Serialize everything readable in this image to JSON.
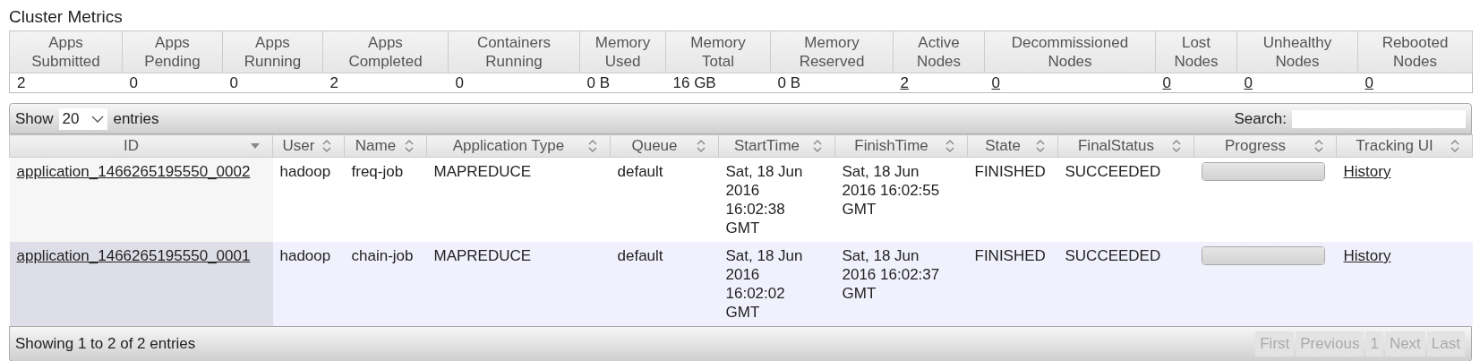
{
  "title": "Cluster Metrics",
  "metrics": [
    {
      "label": "Apps Submitted",
      "value": "2",
      "link": false
    },
    {
      "label": "Apps Pending",
      "value": "0",
      "link": false
    },
    {
      "label": "Apps Running",
      "value": "0",
      "link": false
    },
    {
      "label": "Apps Completed",
      "value": "2",
      "link": false
    },
    {
      "label": "Containers Running",
      "value": "0",
      "link": false
    },
    {
      "label": "Memory Used",
      "value": "0 B",
      "link": false
    },
    {
      "label": "Memory Total",
      "value": "16 GB",
      "link": false
    },
    {
      "label": "Memory Reserved",
      "value": "0 B",
      "link": false
    },
    {
      "label": "Active Nodes",
      "value": "2",
      "link": true
    },
    {
      "label": "Decommissioned Nodes",
      "value": "0",
      "link": true
    },
    {
      "label": "Lost Nodes",
      "value": "0",
      "link": true
    },
    {
      "label": "Unhealthy Nodes",
      "value": "0",
      "link": true
    },
    {
      "label": "Rebooted Nodes",
      "value": "0",
      "link": true
    }
  ],
  "length_menu": {
    "before": "Show",
    "value": "20",
    "after": "entries"
  },
  "search": {
    "label": "Search:"
  },
  "columns": [
    {
      "label": "ID",
      "sorted": true
    },
    {
      "label": "User",
      "sorted": false
    },
    {
      "label": "Name",
      "sorted": false
    },
    {
      "label": "Application Type",
      "sorted": false
    },
    {
      "label": "Queue",
      "sorted": false
    },
    {
      "label": "StartTime",
      "sorted": false
    },
    {
      "label": "FinishTime",
      "sorted": false
    },
    {
      "label": "State",
      "sorted": false
    },
    {
      "label": "FinalStatus",
      "sorted": false
    },
    {
      "label": "Progress",
      "sorted": false
    },
    {
      "label": "Tracking UI",
      "sorted": false
    }
  ],
  "rows": [
    {
      "id": "application_1466265195550_0002",
      "user": "hadoop",
      "name": "freq-job",
      "type": "MAPREDUCE",
      "queue": "default",
      "start": "Sat, 18 Jun 2016 16:02:38 GMT",
      "finish": "Sat, 18 Jun 2016 16:02:55 GMT",
      "state": "FINISHED",
      "final": "SUCCEEDED",
      "level": 1,
      "tracking": "History"
    },
    {
      "id": "application_1466265195550_0001",
      "user": "hadoop",
      "name": "chain-job",
      "type": "MAPREDUCE",
      "queue": "default",
      "start": "Sat, 18 Jun 2016 16:02:02 GMT",
      "finish": "Sat, 18 Jun 2016 16:02:37 GMT",
      "state": "FINISHED",
      "final": "SUCCEEDED",
      "level": 1,
      "tracking": "History"
    }
  ],
  "info": "Showing 1 to 2 of 2 entries",
  "pager": [
    {
      "label": "First",
      "disabled": true
    },
    {
      "label": "Previous",
      "disabled": true
    },
    {
      "label": "1",
      "disabled": true
    },
    {
      "label": "Next",
      "disabled": true
    },
    {
      "label": "Last",
      "disabled": true
    }
  ]
}
